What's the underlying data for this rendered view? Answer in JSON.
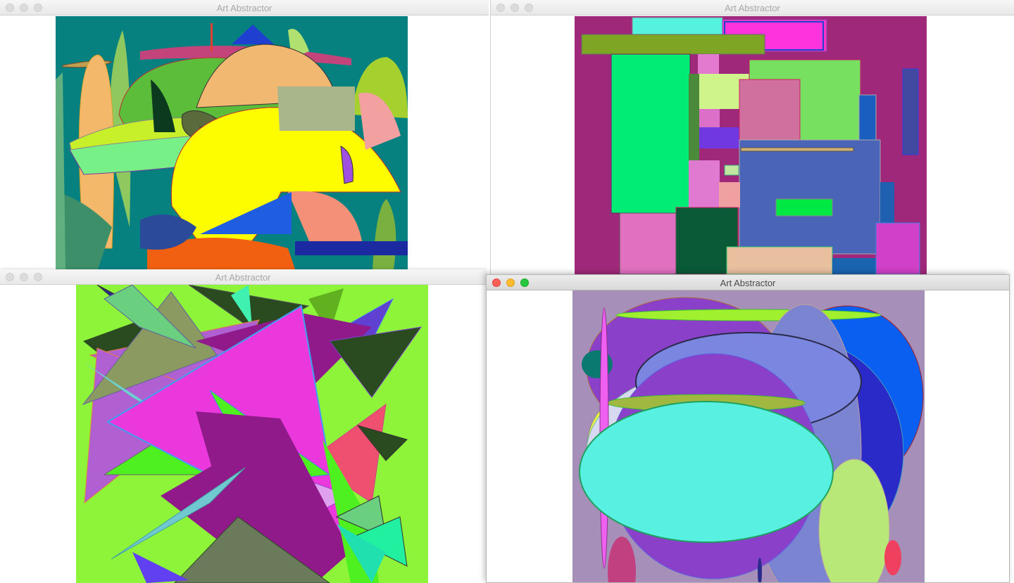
{
  "windows": [
    {
      "title": "Art Abstractor",
      "active": false,
      "art": "abstract-curves-composition"
    },
    {
      "title": "Art Abstractor",
      "active": false,
      "art": "abstract-rectangles-composition"
    },
    {
      "title": "Art Abstractor",
      "active": false,
      "art": "abstract-triangles-composition"
    },
    {
      "title": "Art Abstractor",
      "active": true,
      "art": "abstract-ellipses-composition"
    }
  ],
  "icons": {
    "close": "close-traffic-light-icon",
    "minimize": "minimize-traffic-light-icon",
    "maximize": "maximize-traffic-light-icon"
  },
  "colors": {
    "close": "#fe5f57",
    "minimize": "#febc2e",
    "maximize": "#28c840",
    "canvas1_bg": "#078080",
    "canvas2_bg": "#a0287a",
    "canvas3_bg": "#8ef43a",
    "canvas4_bg": "#a68fb8"
  }
}
